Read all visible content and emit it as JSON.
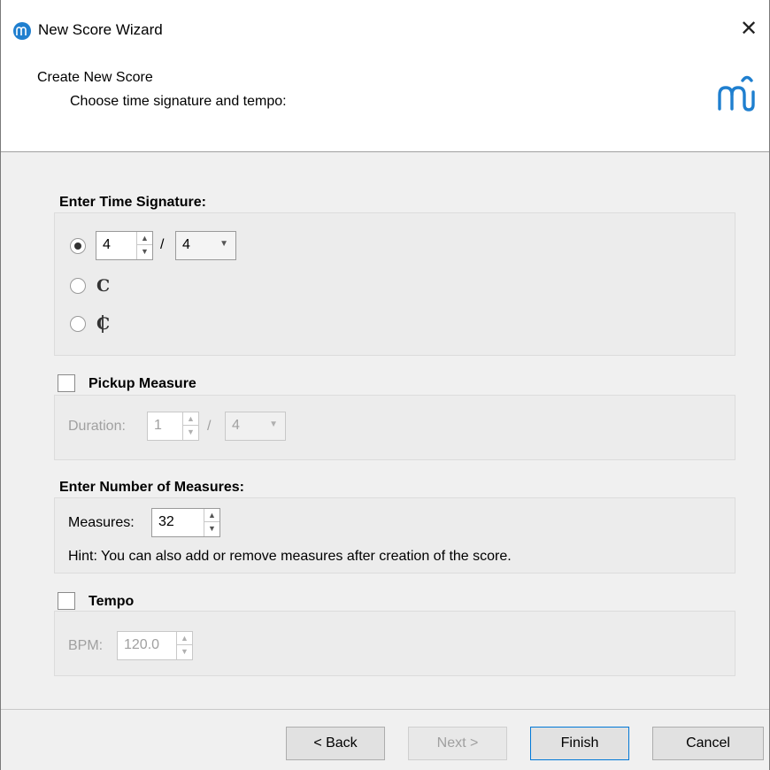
{
  "window": {
    "title": "New Score Wizard",
    "close_symbol": "✕"
  },
  "header": {
    "title": "Create New Score",
    "subtitle": "Choose time signature and tempo:"
  },
  "time_signature": {
    "group_title": "Enter Time Signature:",
    "numerator": "4",
    "slash": "/",
    "denominator": "4",
    "selected_option": "numeric",
    "common_time_symbol": "𝄴",
    "cut_time_symbol": "𝄵"
  },
  "pickup": {
    "group_title": "Pickup Measure",
    "checked": false,
    "duration_label": "Duration:",
    "numerator": "1",
    "slash": "/",
    "denominator": "4"
  },
  "measures": {
    "group_title": "Enter Number of Measures:",
    "label": "Measures:",
    "value": "32",
    "hint": "Hint: You can also add or remove measures after creation of the score."
  },
  "tempo": {
    "group_title": "Tempo",
    "checked": false,
    "bpm_label": "BPM:",
    "bpm_value": "120.0"
  },
  "buttons": {
    "back": "< Back",
    "next": "Next >",
    "finish": "Finish",
    "cancel": "Cancel"
  },
  "colors": {
    "accent": "#0078d7",
    "app_icon": "#1f7fcf"
  }
}
